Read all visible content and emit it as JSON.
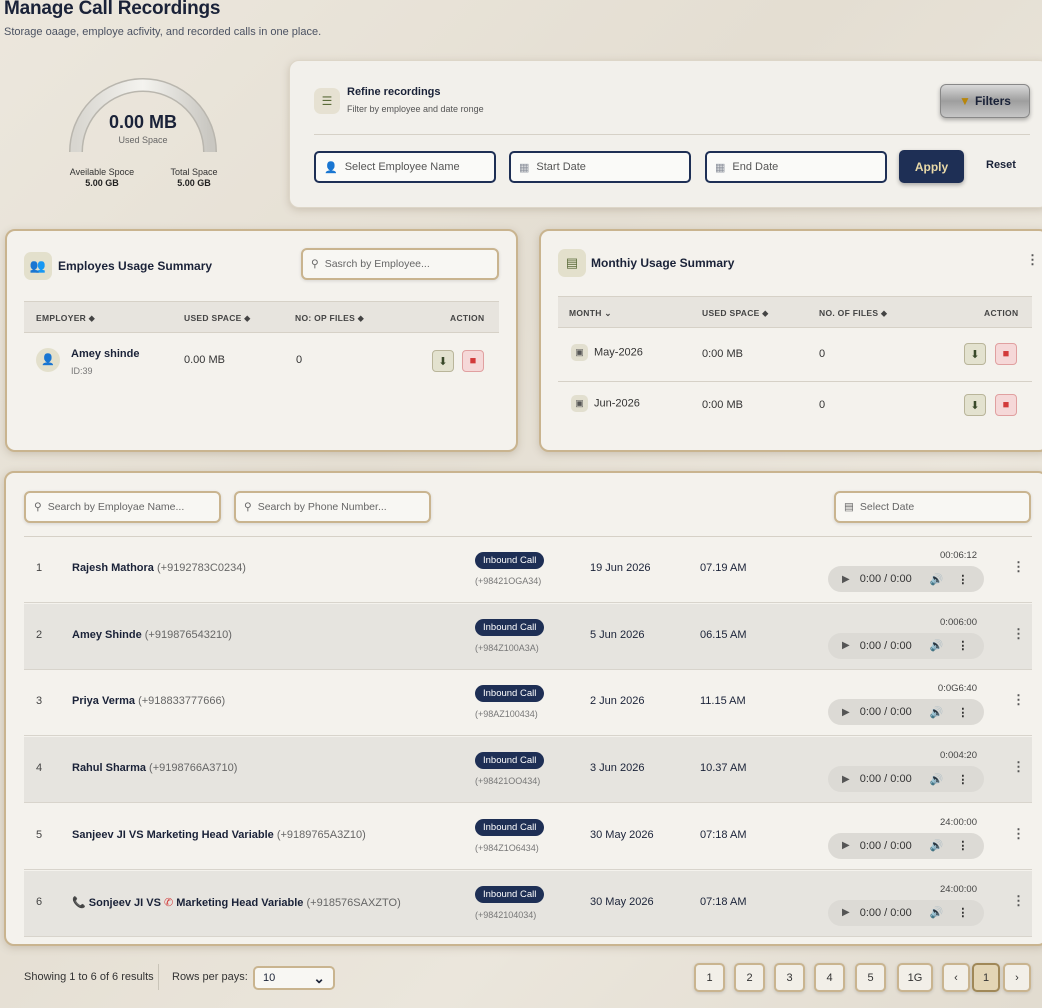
{
  "header": {
    "title": "Manage Call Recordings",
    "subtitle": "Storage oaage, employe acfivity, and recorded calls in one place."
  },
  "storage": {
    "used_value": "0.00 MB",
    "used_label": "Used Space",
    "used_fraction": 0,
    "available_label": "Aveilable Spoce",
    "available_value": "5.00 GB",
    "total_label": "Total Space",
    "total_value": "5.00 GB"
  },
  "filters": {
    "title": "Refine recordings",
    "subtitle": "Filter by employee and date ronge",
    "filters_button": "Filters",
    "employee_placeholder": "Select Employee Name",
    "start_placeholder": "Start Date",
    "end_placeholder": "End Date",
    "apply_label": "Apply",
    "reset_label": "Reset"
  },
  "employee_summary": {
    "title": "Employes Usage Summary",
    "search_placeholder": "Sasrch by Employee...",
    "columns": [
      "EMPLOYER",
      "USED SPACE",
      "NO: OP FILES",
      "ACTION"
    ],
    "rows": [
      {
        "name": "Amey shinde",
        "sub": "ID:39",
        "used": "0.00 MB",
        "files": "0"
      }
    ]
  },
  "monthly_summary": {
    "title": "Monthiy Usage Summary",
    "columns": [
      "MONTH",
      "USED SPACE",
      "NO. OF FILES",
      "ACTION"
    ],
    "rows": [
      {
        "month": "May-2026",
        "used": "0:00 MB",
        "files": "0"
      },
      {
        "month": "Jun-2026",
        "used": "0:00 MB",
        "files": "0"
      }
    ]
  },
  "calls": {
    "search_name_placeholder": "Search by Employae Name...",
    "search_phone_placeholder": "Search by Phone Number...",
    "date_placeholder": "Select Date",
    "rows": [
      {
        "n": "1",
        "name": "Rajesh Mathora",
        "phone": "(+9192783C0234)",
        "badge": "Inbound Call",
        "bnum": "(+98421OGA34)",
        "date": "19 Jun 2026",
        "time": "07.19 AM",
        "dur": "00:06:12",
        "player": "0:00 / 0:00"
      },
      {
        "n": "2",
        "name": "Amey Shinde",
        "phone": "(+919876543210)",
        "badge": "Inbound Call",
        "bnum": "(+984Z100A3A)",
        "date": "5 Jun 2026",
        "time": "06.15 AM",
        "dur": "0:006:00",
        "player": "0:00 / 0:00"
      },
      {
        "n": "3",
        "name": "Priya Verma",
        "phone": "(+918833777666)",
        "badge": "Inbound Call",
        "bnum": "(+98AZ100434)",
        "date": "2 Jun 2026",
        "time": "11.15 AM",
        "dur": "0:0G6:40",
        "player": "0:00 / 0:00"
      },
      {
        "n": "4",
        "name": "Rahul Sharma",
        "phone": "(+9198766A3710)",
        "badge": "Inbound Call",
        "bnum": "(+98421OO434)",
        "date": "3 Jun 2026",
        "time": "10.37 AM",
        "dur": "0:004:20",
        "player": "0:00 / 0:00"
      },
      {
        "n": "5",
        "name": "Sanjeev JI VS Marketing Head Variable",
        "phone": "(+9189765A3Z10)",
        "badge": "Inbound Call",
        "bnum": "(+984Z1O6434)",
        "date": "30 May 2026",
        "time": "07:18 AM",
        "dur": "24:00:00",
        "player": "0:00 / 0:00"
      },
      {
        "n": "6",
        "name": "Sonjeev JI VS",
        "name2": "Marketing Head Variable",
        "phone": "(+918576SAXZTO)",
        "badge": "Inbound Call",
        "bnum": "(+9842104034)",
        "date": "30 May 2026",
        "time": "07:18 AM",
        "dur": "24:00:00",
        "player": "0:00 / 0:00"
      }
    ]
  },
  "footer": {
    "showing": "Showing 1 to 6 of 6 results",
    "rows_label": "Rows per pays:",
    "rows_value": "10",
    "pages": [
      "1",
      "2",
      "3",
      "4",
      "5",
      "1G"
    ],
    "current": "1",
    "prev": "‹",
    "next": "›"
  },
  "colors": {
    "accent": "#1e2f55",
    "border_gold": "#c9b48f",
    "delete": "#d23a3a"
  }
}
